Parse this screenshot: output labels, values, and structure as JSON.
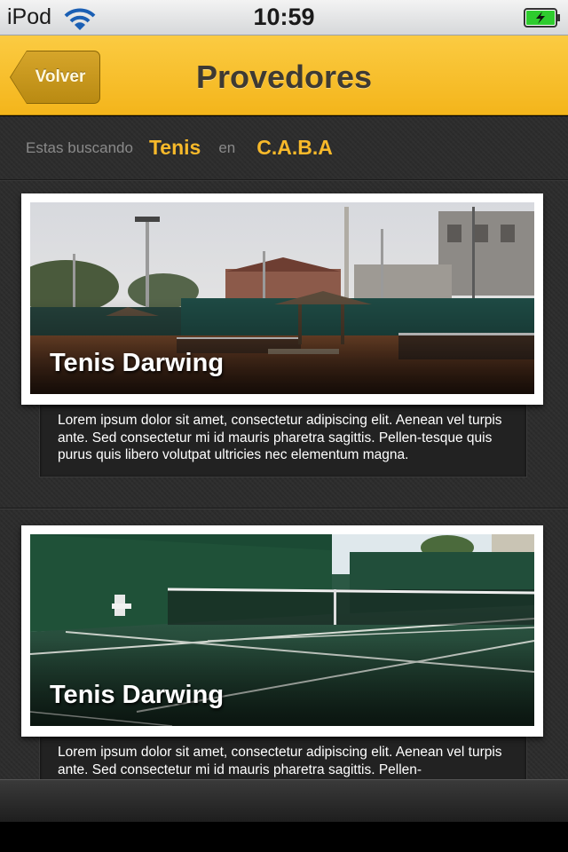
{
  "status_bar": {
    "carrier": "iPod",
    "time": "10:59",
    "battery_color": "#2ecc2e"
  },
  "nav": {
    "back_label": "Volver",
    "title": "Provedores",
    "accent": "#f7b92a"
  },
  "search": {
    "prefix": "Estas buscando",
    "term": "Tenis",
    "connector": "en",
    "location": "C.A.B.A"
  },
  "cards": [
    {
      "title": "Tenis Darwing",
      "description": "Lorem ipsum dolor sit amet, consectetur adipiscing elit. Aenean vel turpis ante. Sed consectetur mi id mauris pharetra sagittis. Pellen-tesque quis purus quis libero volutpat ultricies nec elementum magna.",
      "image": "clay-tennis-courts-photo"
    },
    {
      "title": "Tenis Darwing",
      "description": "Lorem ipsum dolor sit amet, consectetur adipiscing elit. Aenean vel turpis ante. Sed consectetur mi id mauris pharetra sagittis. Pellen-",
      "image": "green-tennis-court-photo"
    }
  ]
}
